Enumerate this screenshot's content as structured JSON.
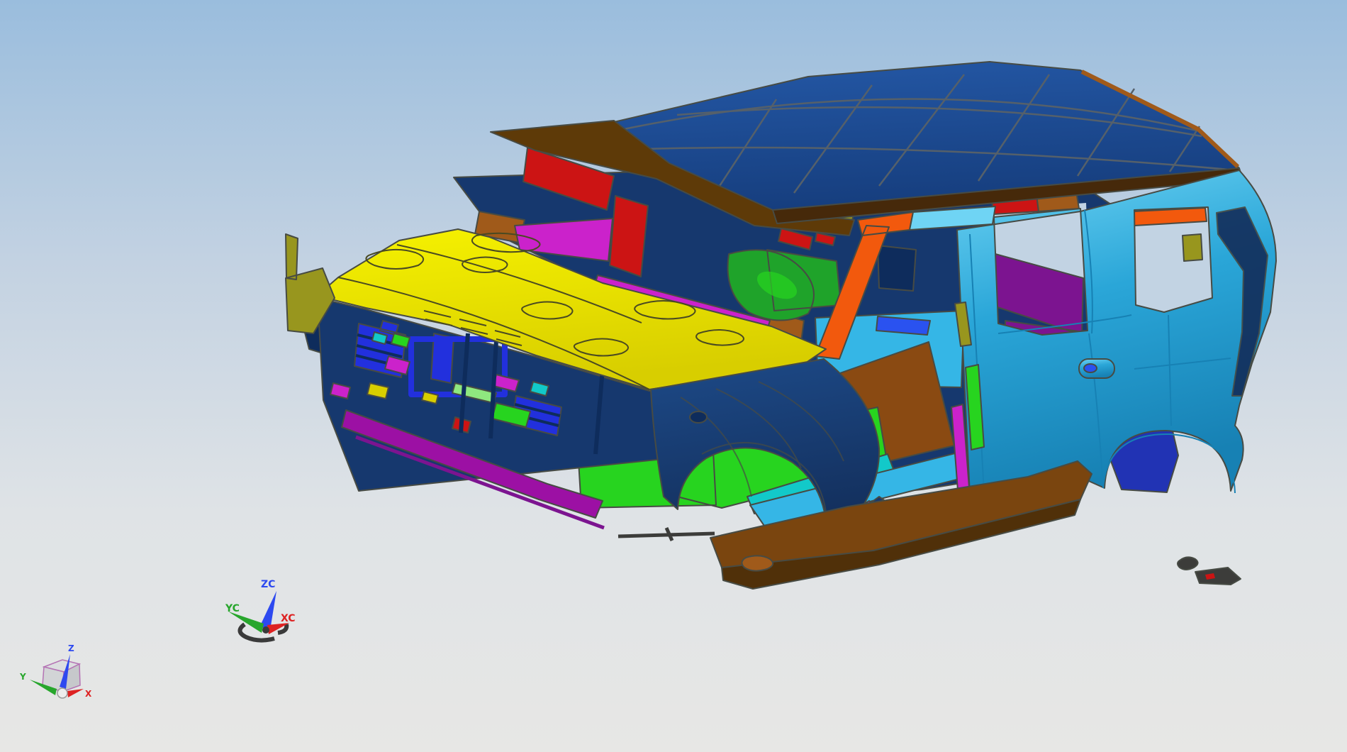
{
  "app": {
    "name": "cad-3d-viewport",
    "model_label": "car-body-in-white"
  },
  "scene": {
    "background": {
      "top": "#9abddd",
      "upper_mid": "#c3d2e2",
      "lower_mid": "#dfe3e6",
      "bottom": "#e7e7e5"
    },
    "palette": {
      "outline": "#474b44",
      "sky": "#c2d3e3",
      "roof_hi": "#2458a6",
      "roof": "#163e7e",
      "roof_line": "#55606a",
      "header_brown": "#5e3a08",
      "band_brown": "#46290a",
      "hood": "#f6f200",
      "hood_shade": "#d8ce00",
      "hood_line": "#4a4a22",
      "body_hi": "#6fd4f4",
      "body_mid": "#2aa6d8",
      "body_dark": "#1781b4",
      "fender_hi": "#1d4a88",
      "fender": "#132f5c",
      "navy": "#16386e",
      "seat_navy": "#0e2c5c",
      "red": "#cc1414",
      "orange": "#f2590d",
      "copper": "#a05a1a",
      "olive": "#98961e",
      "magenta": "#cb22cb",
      "purple": "#7c1490",
      "bumper": "#9c10a4",
      "green": "#1fa32a",
      "green_bright": "#27d41f",
      "green_light": "#8fe87f",
      "floor_brown": "#8a4a12",
      "floor_cyan": "#35b6e6",
      "teal": "#12c9c9",
      "grille": "#2230dd",
      "blue_bright": "#2a52f0",
      "rocker": "#7a450f",
      "rocker_dark": "#503009",
      "wheelhouse": "#2133b4",
      "part_gray": "#3c3c3a"
    }
  },
  "wcs_triad": {
    "z": {
      "label": "ZC",
      "color": "#2d49f0"
    },
    "y": {
      "label": "YC",
      "color": "#27a62c"
    },
    "x": {
      "label": "XC",
      "color": "#dd2222"
    },
    "handle_color": "#3a3a3a"
  },
  "view_triad": {
    "z": {
      "label": "Z",
      "color": "#2d49f0"
    },
    "y": {
      "label": "Y",
      "color": "#27a62c"
    },
    "x": {
      "label": "X",
      "color": "#dd2222"
    },
    "cube_edge": "#b473b4",
    "cube_face_top": "#dcdee0",
    "cube_face_left": "#d2d4d6",
    "cube_face_right": "#c6c8cb",
    "sphere": "#ededed"
  }
}
